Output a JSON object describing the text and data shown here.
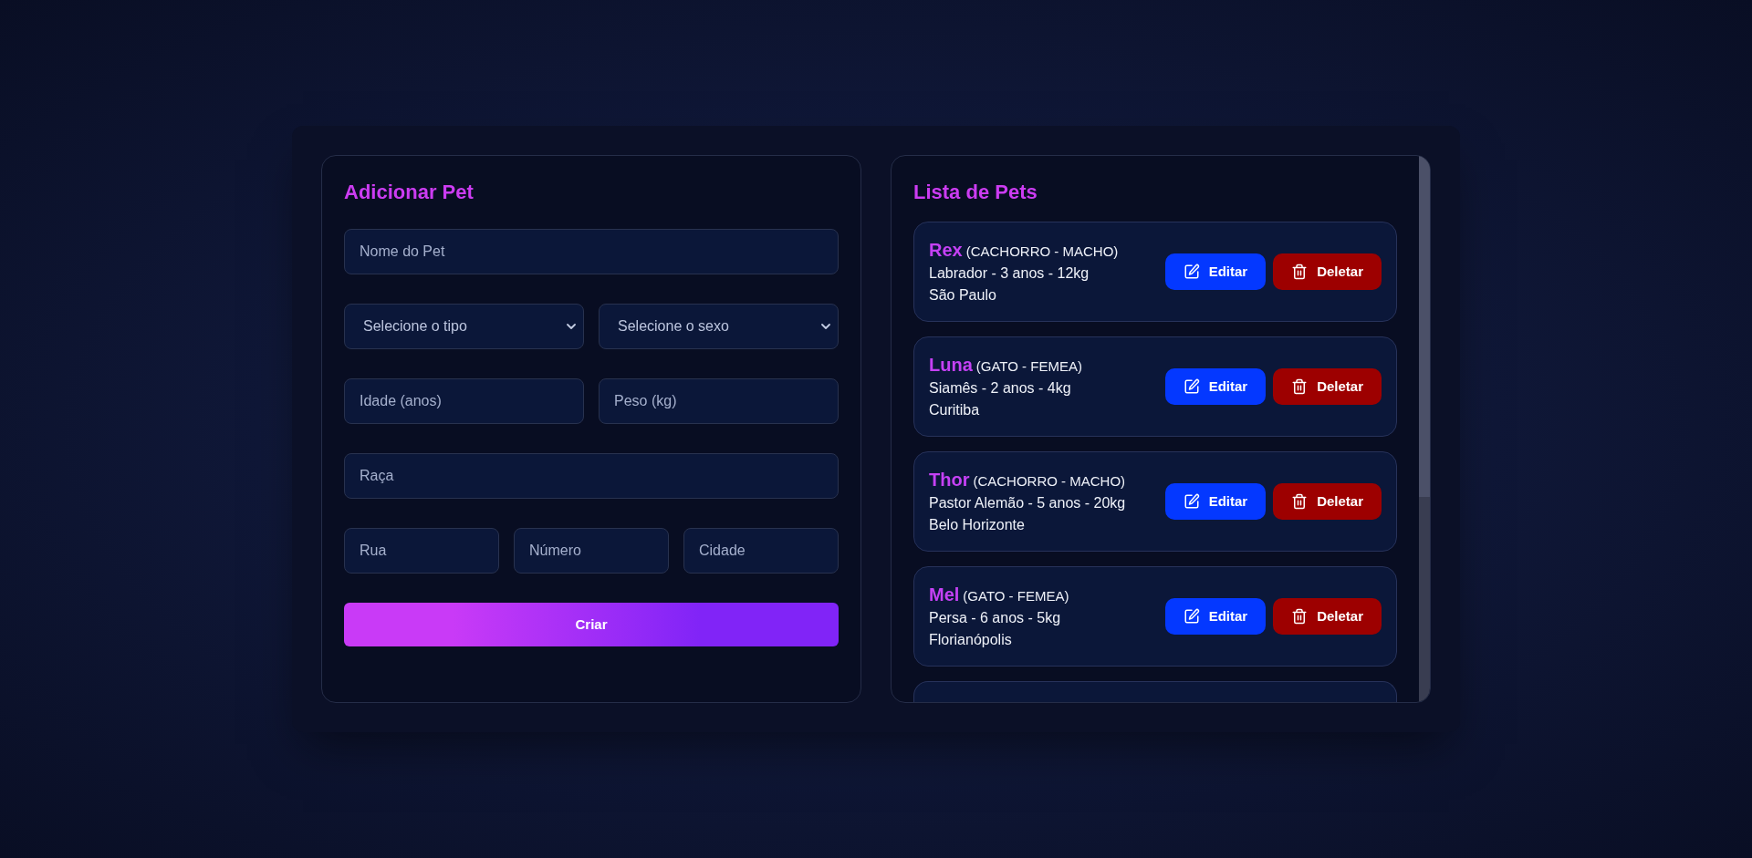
{
  "add_pet_form": {
    "title": "Adicionar Pet",
    "rows": [
      [
        {
          "kind": "text",
          "placeholder": "Nome do Pet"
        }
      ],
      [
        {
          "kind": "select",
          "value": "Selecione o tipo"
        },
        {
          "kind": "select",
          "value": "Selecione o sexo"
        }
      ],
      [
        {
          "kind": "text",
          "placeholder": "Idade (anos)"
        },
        {
          "kind": "text",
          "placeholder": "Peso (kg)"
        }
      ],
      [
        {
          "kind": "text",
          "placeholder": "Raça"
        }
      ],
      [
        {
          "kind": "text",
          "placeholder": "Rua"
        },
        {
          "kind": "text",
          "placeholder": "Número"
        },
        {
          "kind": "text",
          "placeholder": "Cidade"
        }
      ]
    ],
    "submit_button": "Criar"
  },
  "pet_list": {
    "title": "Lista de Pets",
    "pets": [
      {
        "name": "Rex",
        "tags": "(CACHORRO - MACHO)",
        "details": "Labrador - 3 anos - 12kg",
        "city": "São Paulo",
        "actions": [
          {
            "kind": "edit",
            "label": "Editar"
          },
          {
            "kind": "delete",
            "label": "Deletar"
          }
        ]
      },
      {
        "name": "Luna",
        "tags": "(GATO - FEMEA)",
        "details": "Siamês - 2 anos - 4kg",
        "city": "Curitiba",
        "actions": [
          {
            "kind": "edit",
            "label": "Editar"
          },
          {
            "kind": "delete",
            "label": "Deletar"
          }
        ]
      },
      {
        "name": "Thor",
        "tags": "(CACHORRO - MACHO)",
        "details": "Pastor Alemão - 5 anos - 20kg",
        "city": "Belo Horizonte",
        "actions": [
          {
            "kind": "edit",
            "label": "Editar"
          },
          {
            "kind": "delete",
            "label": "Deletar"
          }
        ]
      },
      {
        "name": "Mel",
        "tags": "(GATO - FEMEA)",
        "details": "Persa - 6 anos - 5kg",
        "city": "Florianópolis",
        "actions": [
          {
            "kind": "edit",
            "label": "Editar"
          },
          {
            "kind": "delete",
            "label": "Deletar"
          }
        ]
      }
    ],
    "partial_card_below": true
  }
}
